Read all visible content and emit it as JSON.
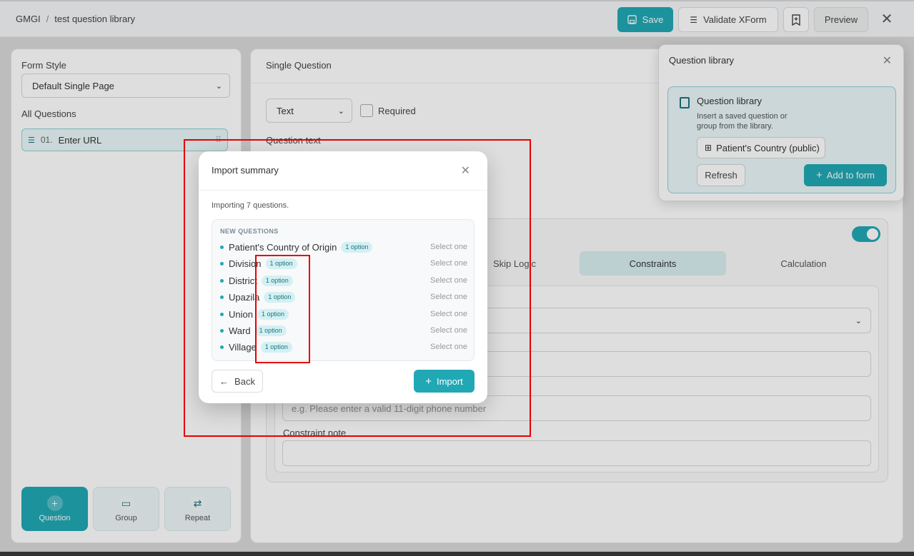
{
  "topbar": {
    "breadcrumb": [
      "GMGI",
      "test question library"
    ],
    "separator": "/",
    "save_label": "Save",
    "validate_label": "Validate XForm",
    "preview_label": "Preview"
  },
  "sidebar": {
    "form_style_label": "Form Style",
    "form_style_value": "Default Single Page",
    "all_questions_label": "All Questions",
    "questions": [
      {
        "number": "01.",
        "label": "Enter URL"
      }
    ],
    "add_tiles": [
      {
        "label": "Question"
      },
      {
        "label": "Group"
      },
      {
        "label": "Repeat"
      }
    ]
  },
  "editor": {
    "title": "Single Question",
    "type_value": "Text",
    "required_label": "Required",
    "question_text_label": "Question text",
    "tabs": [
      "Skip Logic",
      "Constraints",
      "Calculation"
    ],
    "active_tab": "Constraints",
    "constraint_message_placeholder": "e.g. Please enter a valid 11-digit phone number",
    "constraint_note_label": "Constraint note"
  },
  "library": {
    "header": "Question library",
    "card_title": "Question library",
    "card_desc": "Insert a saved question or group from the library.",
    "selected": "Patient's Country (public)",
    "refresh_label": "Refresh",
    "add_label": "Add to form"
  },
  "modal": {
    "title": "Import summary",
    "subtitle": "Importing 7 questions.",
    "section_label": "NEW QUESTIONS",
    "rows": [
      {
        "name": "Patient's Country of Origin",
        "badge": "1 option",
        "type": "Select one"
      },
      {
        "name": "Division",
        "badge": "1 option",
        "type": "Select one"
      },
      {
        "name": "District",
        "badge": "1 option",
        "type": "Select one"
      },
      {
        "name": "Upazila",
        "badge": "1 option",
        "type": "Select one"
      },
      {
        "name": "Union",
        "badge": "1 option",
        "type": "Select one"
      },
      {
        "name": "Ward",
        "badge": "1 option",
        "type": "Select one"
      },
      {
        "name": "Village",
        "badge": "1 option",
        "type": "Select one"
      }
    ],
    "back_label": "Back",
    "import_label": "Import"
  },
  "colors": {
    "accent": "#21a8b5",
    "annotation": "#e60000"
  }
}
